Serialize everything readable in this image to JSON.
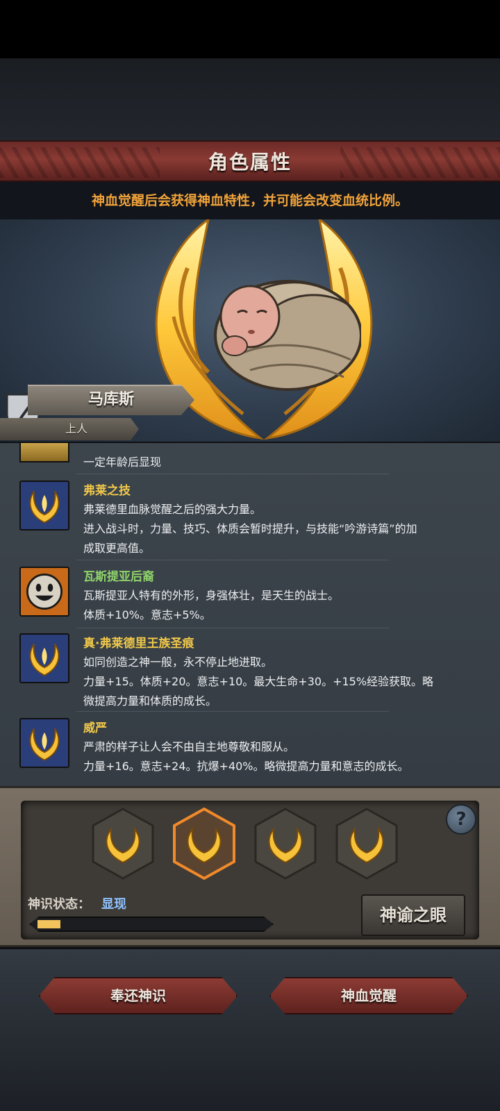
{
  "header": {
    "title": "角色属性",
    "subtitle": "神血觉醒后会获得神血特性，并可能会改变血统比例。"
  },
  "character": {
    "name": "马库斯",
    "rank": "上人"
  },
  "traits": {
    "partial_line": "一定年龄后显现",
    "items": [
      {
        "name": "弗莱之技",
        "color": "#f0c84a",
        "lines": [
          "弗莱德里血脉觉醒之后的强大力量。",
          "进入战斗时，力量、技巧、体质会暂时提升，与技能“吟游诗篇”的加",
          "成取更高值。"
        ]
      },
      {
        "name": "瓦斯提亚后裔",
        "color": "#8fd36a",
        "lines": [
          "瓦斯提亚人特有的外形，身强体壮，是天生的战士。",
          "体质+10%。意志+5%。"
        ]
      },
      {
        "name": "真·弗莱德里王族圣痕",
        "color": "#f0c84a",
        "lines": [
          "如同创造之神一般，永不停止地进取。",
          "力量+15。体质+20。意志+10。最大生命+30。+15%经验获取。略",
          "微提高力量和体质的成长。"
        ]
      },
      {
        "name": "威严",
        "color": "#f0c84a",
        "lines": [
          "严肃的样子让人会不由自主地尊敬和服从。",
          "力量+16。意志+24。抗爆+40%。略微提高力量和意志的成长。"
        ]
      }
    ]
  },
  "divine_panel": {
    "help_label": "?",
    "status_label": "神识状态：",
    "status_value": "显现",
    "progress": 0.1,
    "oracle_button": "神谕之眼",
    "selected_slot": 2
  },
  "actions": {
    "return_button": "奉还神识",
    "awaken_button": "神血觉醒"
  },
  "colors": {
    "accent_orange": "#f0a33a",
    "status_blue": "#8fc4ff",
    "gold": "#f0c84a",
    "green": "#8fd36a"
  }
}
